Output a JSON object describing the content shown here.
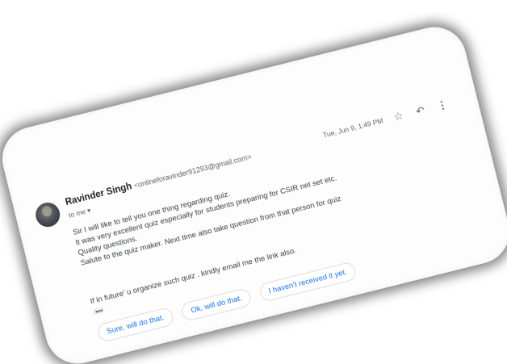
{
  "email": {
    "sender_name": "Ravinder Singh",
    "sender_email": "<onlineforavinder91293@gmail.com>",
    "to_line": "to me ▾",
    "date": "Tue, Jun 9, 1:49 PM",
    "body_lines": [
      "Sir I will like to tell you one thing regarding quiz.",
      "It was very excellent quiz especially for students preparing for CSIR net set etc.",
      "Quality questions.",
      "Salute to the quiz maker. Next time also take question from that person for quiz"
    ],
    "closing_line": "If in future' u organize such quiz . kindly email me the link also.",
    "ellipsis": "•••"
  },
  "actions": {
    "star_icon": "☆",
    "reply_icon": "↶",
    "more_icon": "⋮"
  },
  "smart_replies": [
    "Sure, will do that.",
    "Ok, will do that.",
    "I haven't received it yet."
  ],
  "colors": {
    "accent": "#1a73e8",
    "text": "#3c4043",
    "muted": "#5f6368"
  }
}
